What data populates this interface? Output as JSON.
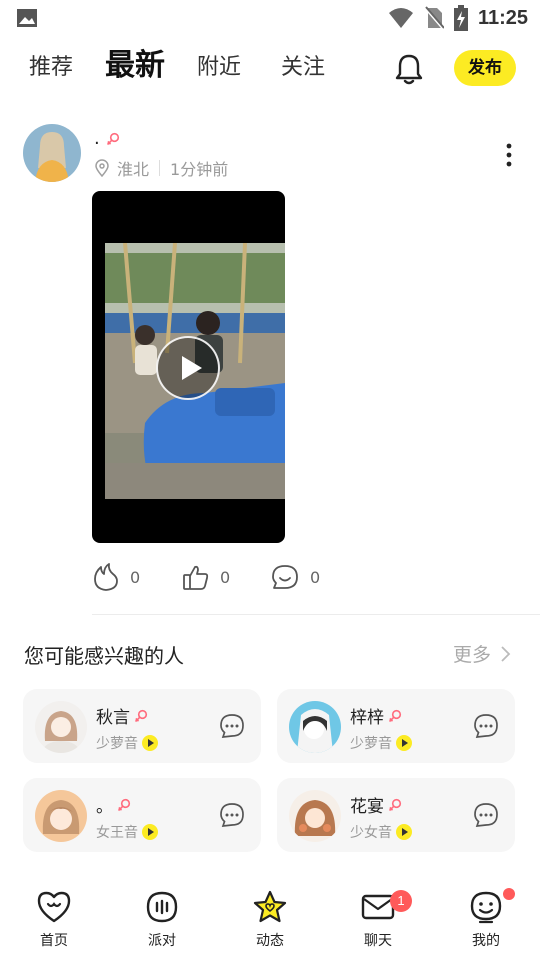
{
  "status_bar": {
    "time": "11:25"
  },
  "top_tabs": {
    "items": [
      {
        "label": "推荐",
        "active": false
      },
      {
        "label": "最新",
        "active": true
      },
      {
        "label": "附近",
        "active": false
      },
      {
        "label": "关注",
        "active": false
      }
    ],
    "publish_label": "发布"
  },
  "post": {
    "username": ".",
    "location": "淮北",
    "time_ago": "1分钟前",
    "reactions": {
      "fire": "0",
      "like": "0",
      "comment": "0"
    }
  },
  "suggestions": {
    "title": "您可能感兴趣的人",
    "more_label": "更多",
    "people": [
      {
        "name": "秋言",
        "voice": "少萝音"
      },
      {
        "name": "梓梓",
        "voice": "少萝音"
      },
      {
        "name": "。",
        "voice": "女王音"
      },
      {
        "name": "花宴",
        "voice": "少女音"
      }
    ]
  },
  "bottom_nav": {
    "items": [
      {
        "label": "首页"
      },
      {
        "label": "派对"
      },
      {
        "label": "动态"
      },
      {
        "label": "聊天",
        "badge": "1"
      },
      {
        "label": "我的"
      }
    ]
  },
  "colors": {
    "accent": "#FCEB23",
    "badge": "#ff5a5a",
    "female": "#ff6b7d"
  }
}
